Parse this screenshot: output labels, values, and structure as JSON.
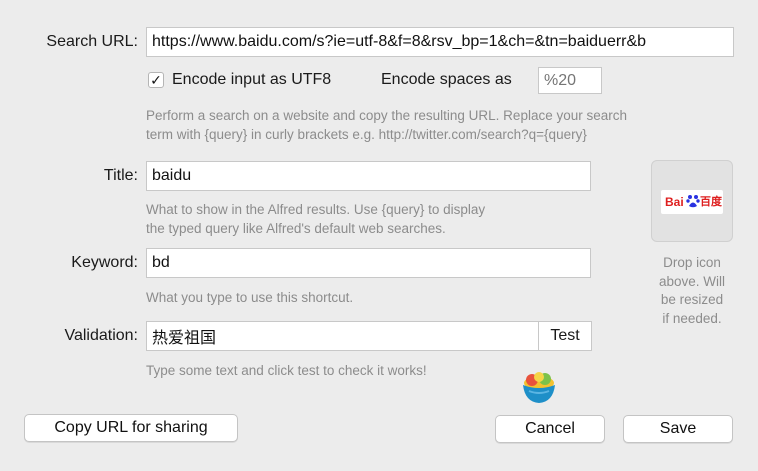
{
  "search_url": {
    "label": "Search URL:",
    "value": "https://www.baidu.com/s?ie=utf-8&f=8&rsv_bp=1&ch=&tn=baiduerr&b"
  },
  "encoding": {
    "utf8_label": "Encode input as UTF8",
    "utf8_checked": true,
    "check_glyph": "✓",
    "spaces_label": "Encode spaces as",
    "spaces_placeholder": "%20"
  },
  "search_hint": [
    "Perform a search on a website and copy the resulting URL. Replace your search",
    "term with {query} in curly brackets e.g. http://twitter.com/search?q={query}"
  ],
  "title": {
    "label": "Title:",
    "value": "baidu",
    "hint": [
      "What to show in the Alfred results. Use {query} to display",
      "the typed query like Alfred's default web searches."
    ]
  },
  "keyword": {
    "label": "Keyword:",
    "value": "bd",
    "hint": "What you type to use this shortcut."
  },
  "validation": {
    "label": "Validation:",
    "value": "热爱祖国",
    "test_label": "Test",
    "hint": "Type some text and click test to check it works!"
  },
  "icon_well": {
    "logo_text_left": "Bai",
    "logo_text_right": "百度",
    "drop_hint": [
      "Drop icon",
      "above. Will",
      "be resized",
      "if needed."
    ]
  },
  "buttons": {
    "copy_url": "Copy URL for sharing",
    "cancel": "Cancel",
    "save": "Save"
  },
  "colors": {
    "baidu_red": "#de1f1f",
    "baidu_blue": "#2932e1"
  }
}
